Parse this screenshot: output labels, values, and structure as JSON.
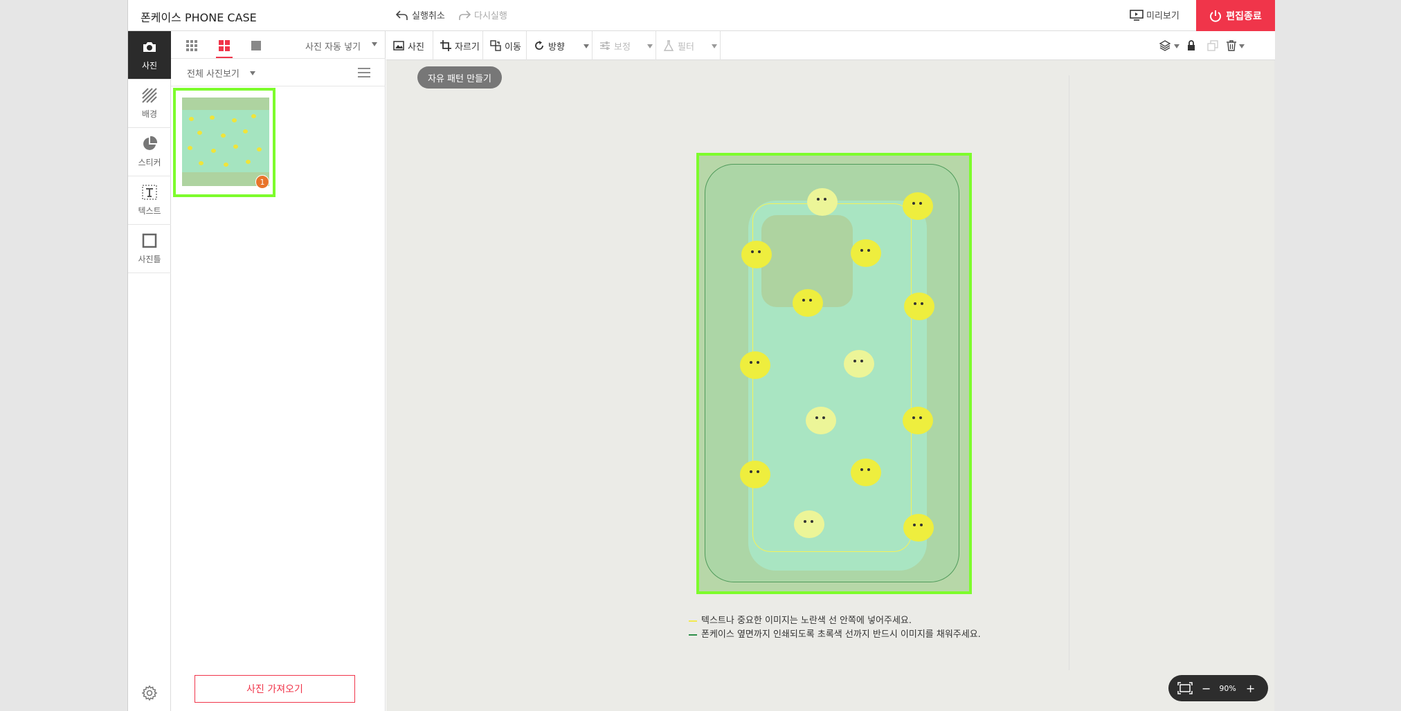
{
  "header": {
    "title": "폰케이스 PHONE CASE",
    "undo_label": "실행취소",
    "redo_label": "다시실행",
    "preview_label": "미리보기",
    "finish_label": "편집종료"
  },
  "rail": {
    "items": [
      {
        "label": "사진",
        "icon": "camera-icon"
      },
      {
        "label": "배경",
        "icon": "stripes-icon"
      },
      {
        "label": "스티커",
        "icon": "pie-icon"
      },
      {
        "label": "텍스트",
        "icon": "text-icon"
      },
      {
        "label": "사진틀",
        "icon": "frame-icon"
      }
    ]
  },
  "panel": {
    "auto_fill_label": "사진 자동 넣기",
    "view_all_label": "전체 사진보기",
    "thumbnail_badge": "1",
    "import_label": "사진 가져오기"
  },
  "toolbar": {
    "photo_label": "사진",
    "crop_label": "자르기",
    "move_label": "이동",
    "rotate_label": "방향",
    "adjust_label": "보정",
    "filter_label": "필터"
  },
  "canvas": {
    "pattern_button_label": "자유 패턴 만들기",
    "legend": [
      {
        "color": "#f2e94e",
        "text": "텍스트나 중요한 이미지는 노란색 선 안쪽에 넣어주세요."
      },
      {
        "color": "#2f8f4a",
        "text": "폰케이스 옆면까지 인쇄되도록 초록색 선까지 반드시 이미지를 채워주세요."
      }
    ]
  },
  "zoom": {
    "minus": "−",
    "level": "90%",
    "plus": "+"
  },
  "colors": {
    "accent": "#f0354a",
    "selection": "#7dfc2c"
  }
}
